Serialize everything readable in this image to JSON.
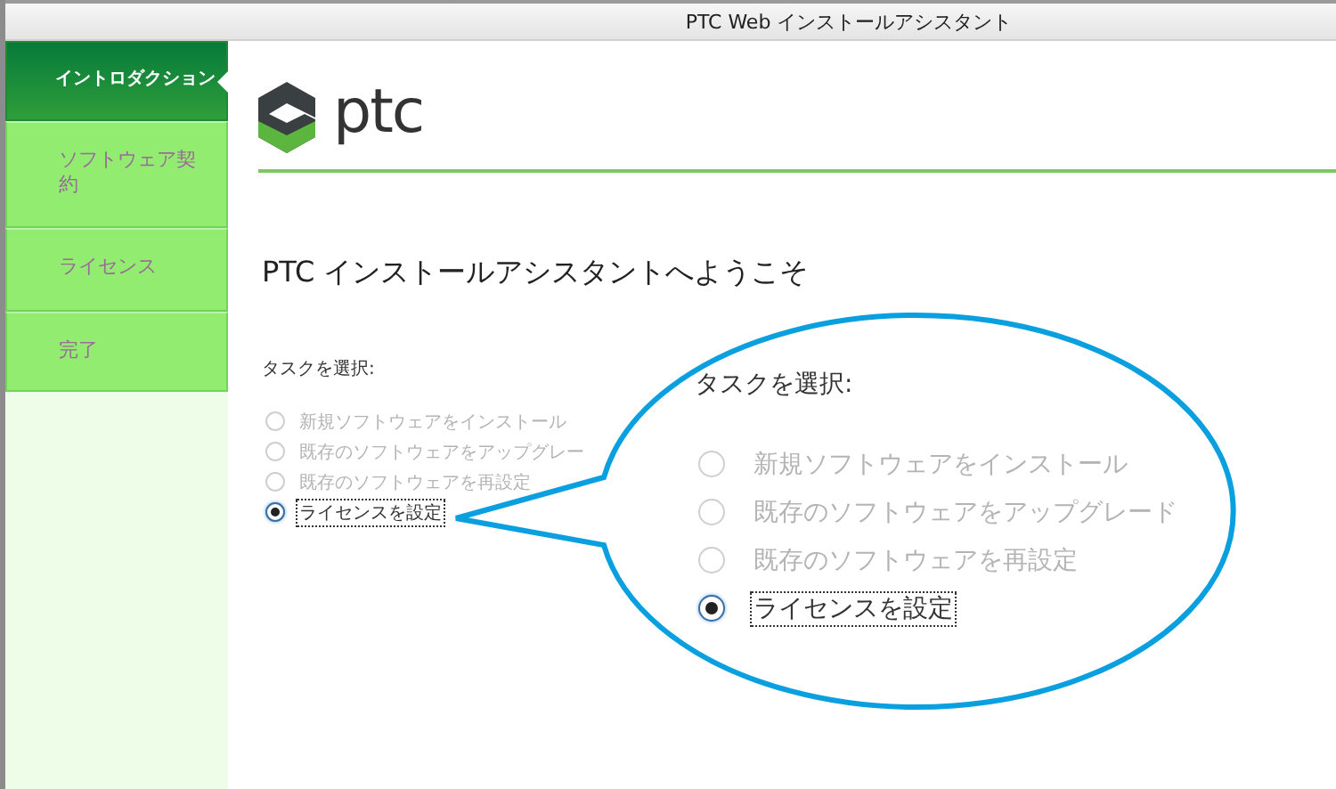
{
  "window": {
    "title": "PTC Web インストールアシスタント"
  },
  "sidebar": {
    "items": [
      {
        "label": "イントロダクション",
        "selected": true
      },
      {
        "label": "ソフトウェア契約",
        "selected": false
      },
      {
        "label": "ライセンス",
        "selected": false
      },
      {
        "label": "完了",
        "selected": false
      }
    ]
  },
  "logo": {
    "text": "ptc"
  },
  "heading": "PTC インストールアシスタントへようこそ",
  "tasks": {
    "label": "タスクを選択:",
    "options": [
      {
        "label": "新規ソフトウェアをインストール",
        "selected": false,
        "disabled": true
      },
      {
        "label": "既存のソフトウェアをアップグレー",
        "selected": false,
        "disabled": true
      },
      {
        "label": "既存のソフトウェアを再設定",
        "selected": false,
        "disabled": true
      },
      {
        "label": "ライセンスを設定",
        "selected": true,
        "disabled": false
      }
    ]
  },
  "callout": {
    "label": "タスクを選択:",
    "options": [
      {
        "label": "新規ソフトウェアをインストール",
        "selected": false,
        "disabled": true
      },
      {
        "label": "既存のソフトウェアをアップグレード",
        "selected": false,
        "disabled": true
      },
      {
        "label": "既存のソフトウェアを再設定",
        "selected": false,
        "disabled": true
      },
      {
        "label": "ライセンスを設定",
        "selected": true,
        "disabled": false
      }
    ]
  }
}
